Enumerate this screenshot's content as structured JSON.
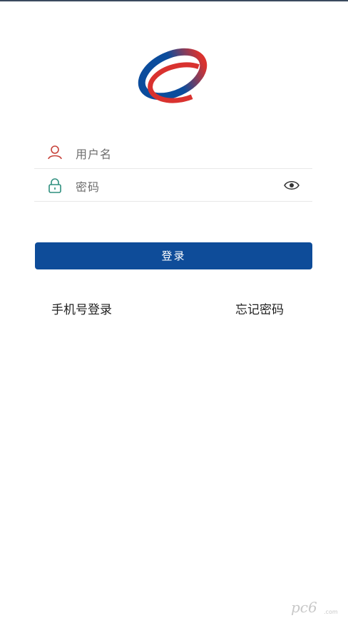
{
  "login_form": {
    "username_placeholder": "用户名",
    "password_placeholder": "密码",
    "submit_label": "登录"
  },
  "links": {
    "phone_login": "手机号登录",
    "forgot_password": "忘记密码"
  },
  "watermark": {
    "logo_text": "pc6",
    "site": ".com"
  },
  "icons": {
    "username": "user-icon",
    "password": "lock-icon",
    "toggle_password": "eye-icon"
  },
  "colors": {
    "primary": "#0e4c99",
    "logo_blue": "#0b4c9c",
    "logo_red": "#d9322f",
    "user_icon": "#c7423a",
    "lock_icon": "#2f8f7f"
  }
}
